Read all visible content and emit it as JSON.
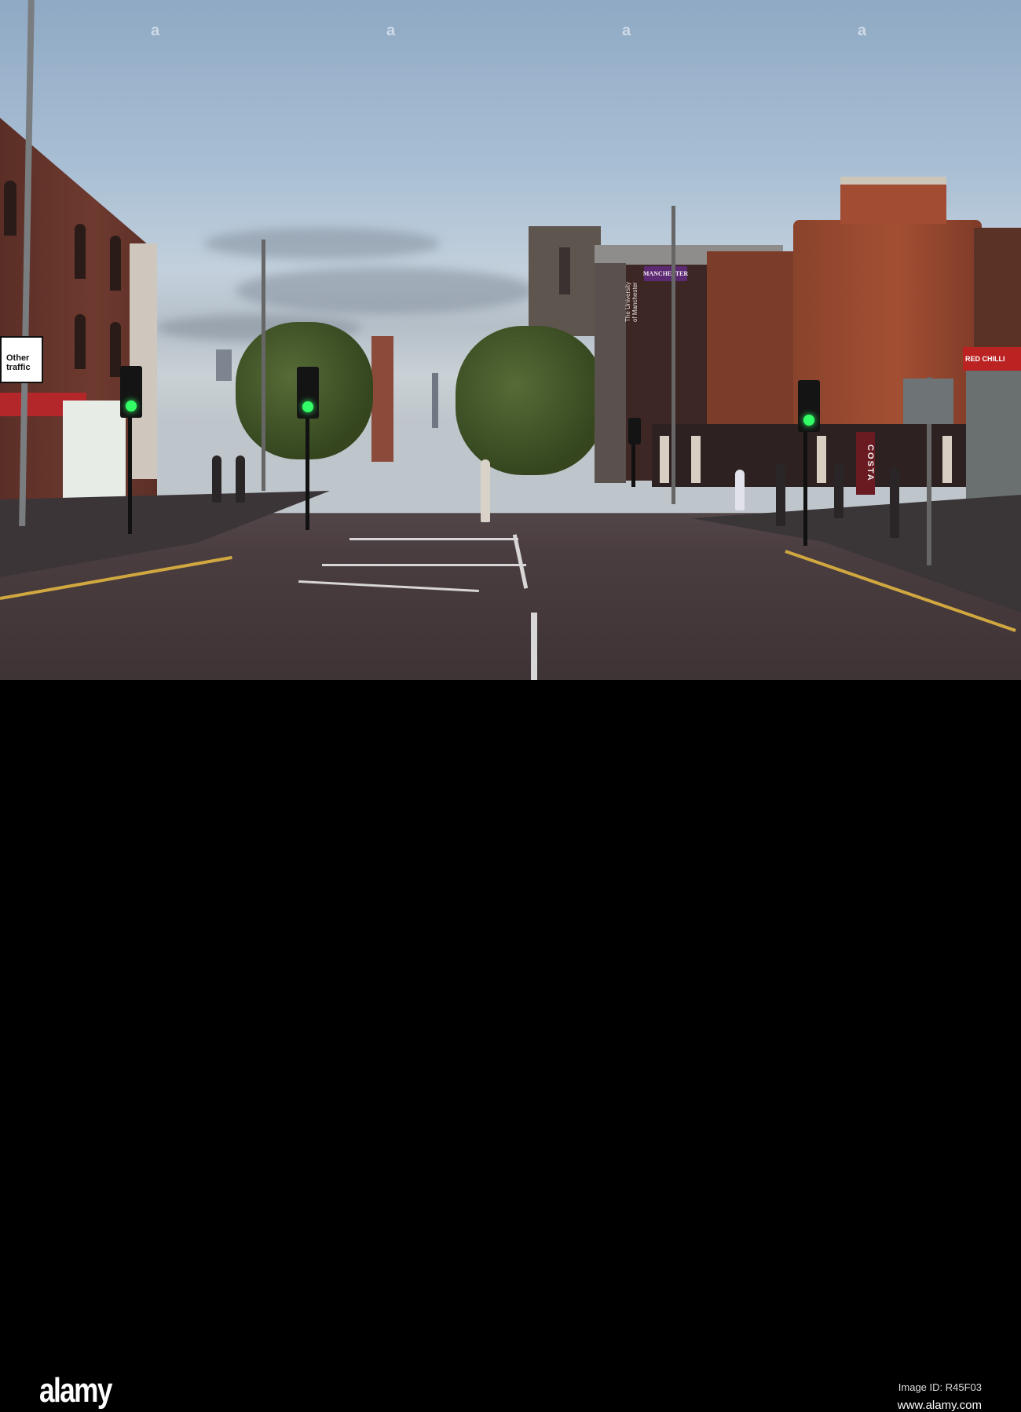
{
  "signs": {
    "other_traffic": "Other traffic",
    "university_banner": "MANCHESTER",
    "university_wall_text": "The University\nof Manchester",
    "costa": "COSTA",
    "shop_sign": "RED CHILLI"
  },
  "watermark": {
    "logo": "alamy",
    "tile_mark": "a",
    "image_id": "Image ID: R45F03",
    "url": "www.alamy.com"
  },
  "colors": {
    "sky": "#a9bfd4",
    "brick": "#a34f33",
    "road": "#4a3d40",
    "signal_green": "#33ff66",
    "university_purple": "#5c2a72"
  }
}
